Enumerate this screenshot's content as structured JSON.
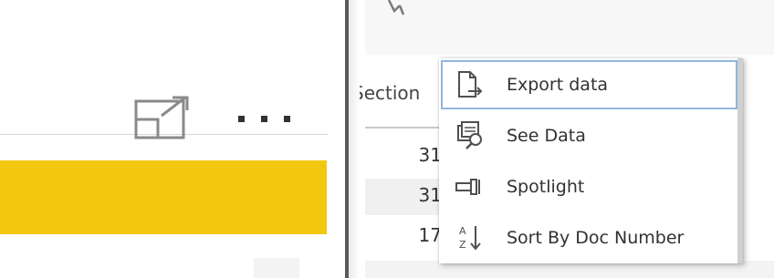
{
  "table": {
    "column_header": "Section",
    "rows": [
      "31",
      "31",
      "17"
    ]
  },
  "context_menu": {
    "items": [
      {
        "label": "Export data",
        "icon": "export-data-icon"
      },
      {
        "label": "See Data",
        "icon": "see-data-icon"
      },
      {
        "label": "Spotlight",
        "icon": "spotlight-icon"
      },
      {
        "label": "Sort By Doc Number",
        "icon": "sort-az-icon"
      }
    ]
  },
  "colors": {
    "accent": "#f2c811",
    "menu_focus": "#92b6e0",
    "divider": "#5a5a5a"
  }
}
